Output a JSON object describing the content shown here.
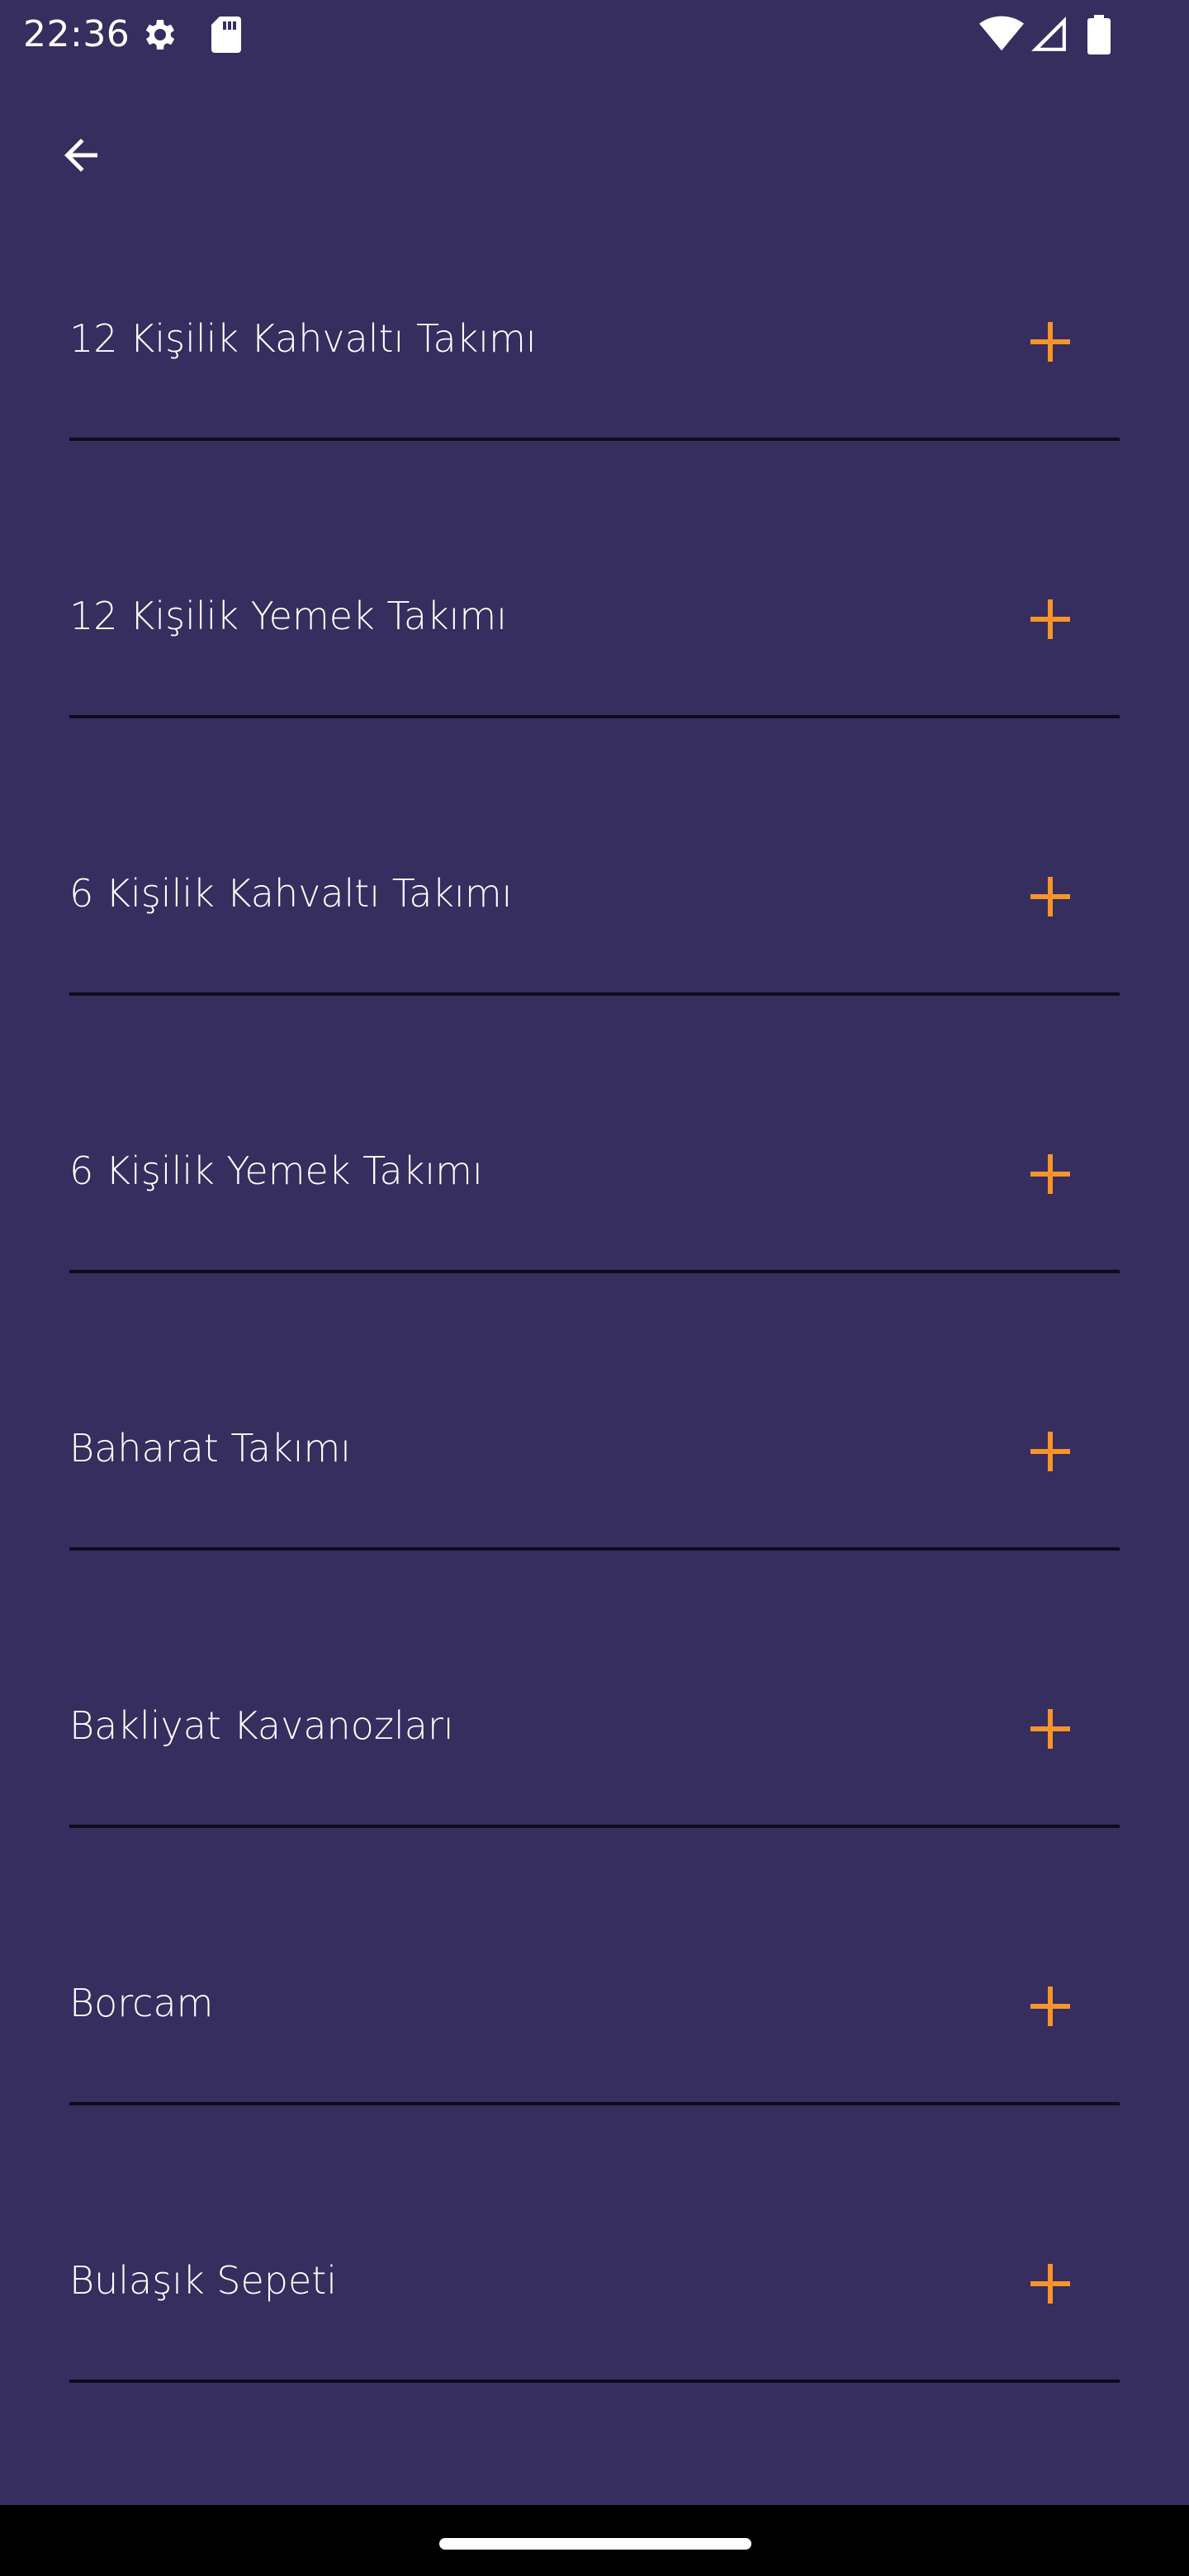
{
  "status_bar": {
    "time": "22:36",
    "icons": [
      "settings-gear-icon",
      "sd-card-icon",
      "wifi-icon",
      "cell-signal-icon",
      "battery-icon"
    ]
  },
  "app_bar": {
    "back_icon": "arrow-left-icon"
  },
  "colors": {
    "background": "#352e5e",
    "accent": "#f7942a",
    "divider": "#0e0c1c",
    "text": "#ffffff"
  },
  "items": [
    {
      "label": "12 Kişilik Kahvaltı Takımı",
      "icon": "plus-icon"
    },
    {
      "label": "12 Kişilik Yemek Takımı",
      "icon": "plus-icon"
    },
    {
      "label": "6 Kişilik Kahvaltı Takımı",
      "icon": "plus-icon"
    },
    {
      "label": "6 Kişilik Yemek Takımı",
      "icon": "plus-icon"
    },
    {
      "label": "Baharat Takımı",
      "icon": "plus-icon"
    },
    {
      "label": "Bakliyat Kavanozları",
      "icon": "plus-icon"
    },
    {
      "label": "Borcam",
      "icon": "plus-icon"
    },
    {
      "label": "Bulaşık Sepeti",
      "icon": "plus-icon"
    }
  ]
}
